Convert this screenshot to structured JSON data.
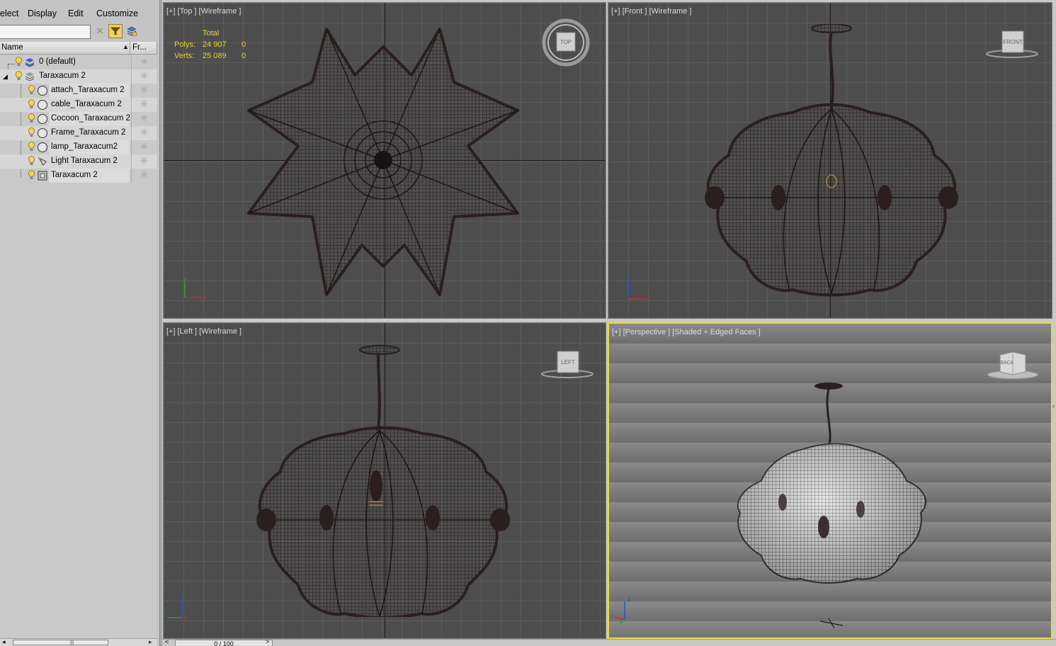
{
  "menu": {
    "select": "elect",
    "display": "Display",
    "edit": "Edit",
    "customize": "Customize"
  },
  "toolbar": {
    "search_value": "",
    "clear_icon": "✕",
    "filter_icon": "filter-icon",
    "layers_icon": "layers-icon"
  },
  "columns": {
    "name": "Name",
    "frozen": "Fr..."
  },
  "scene_items": [
    {
      "label": "0 (default)",
      "type": "layer"
    },
    {
      "label": "Taraxacum 2",
      "type": "layer"
    },
    {
      "label": "attach_Taraxacum 2",
      "type": "geometry"
    },
    {
      "label": "cable_Taraxacum 2",
      "type": "geometry"
    },
    {
      "label": "Cocoon_Taraxacum 2",
      "type": "geometry"
    },
    {
      "label": "Frame_Taraxacum 2",
      "type": "geometry"
    },
    {
      "label": "lamp_Taraxacum2",
      "type": "geometry"
    },
    {
      "label": "Light Taraxacum 2",
      "type": "light"
    },
    {
      "label": "Taraxacum 2",
      "type": "group"
    }
  ],
  "viewports": {
    "top": {
      "label": "[+] [Top ] [Wireframe ]",
      "navcube": "TOP"
    },
    "front": {
      "label": "[+] [Front ] [Wireframe ]",
      "navcube": "FRONT"
    },
    "left": {
      "label": "[+] [Left ] [Wireframe ]",
      "navcube": "LEFT"
    },
    "perspective": {
      "label": "[+] [Perspective ] [Shaded + Edged Faces ]",
      "navcube": "BACK"
    }
  },
  "stats": {
    "header": "Total",
    "polys_label": "Polys:",
    "polys_value": "24 907",
    "polys_sel": "0",
    "verts_label": "Verts:",
    "verts_value": "25 089",
    "verts_sel": "0"
  },
  "timeline": {
    "frame": "0 / 100",
    "prev": "<",
    "next": ">"
  },
  "axes": {
    "x": "x",
    "y": "y",
    "z": "z"
  },
  "colors": {
    "active_viewport": "#e6dc3a",
    "stats_text": "#e6d23a",
    "viewport_bg": "#4d4d4d",
    "wire": "#3a2a2a"
  }
}
